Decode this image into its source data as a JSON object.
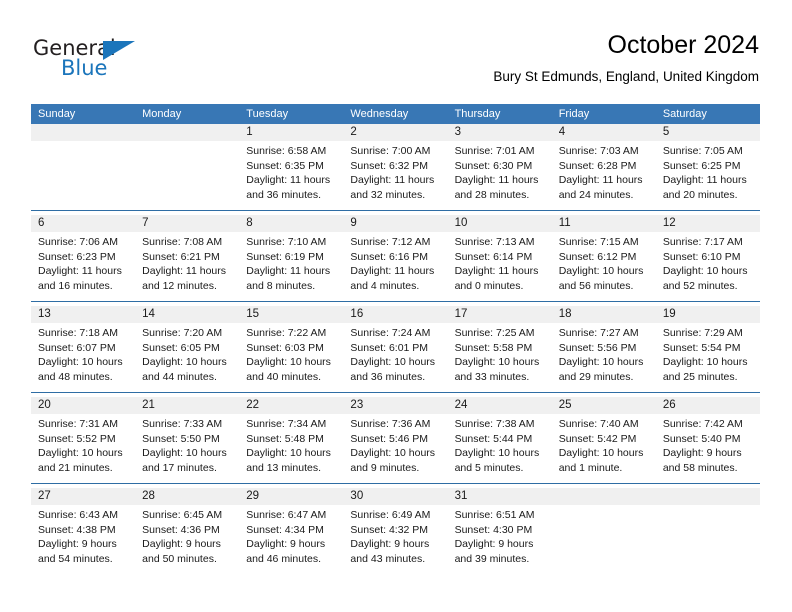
{
  "brand": {
    "name_part1": "General",
    "name_part2": "Blue",
    "triangle_icon": "triangle-icon",
    "accent_color": "#1b75bb"
  },
  "header": {
    "title": "October 2024",
    "subtitle": "Bury St Edmunds, England, United Kingdom"
  },
  "calendar": {
    "header_bg": "#3877b5",
    "daynum_bg": "#f0f0f0",
    "row_divider_color": "#2e6da4",
    "weekdays": [
      "Sunday",
      "Monday",
      "Tuesday",
      "Wednesday",
      "Thursday",
      "Friday",
      "Saturday"
    ],
    "weeks": [
      {
        "days": [
          {
            "num": "",
            "lines": []
          },
          {
            "num": "",
            "lines": []
          },
          {
            "num": "1",
            "lines": [
              "Sunrise: 6:58 AM",
              "Sunset: 6:35 PM",
              "Daylight: 11 hours and 36 minutes."
            ]
          },
          {
            "num": "2",
            "lines": [
              "Sunrise: 7:00 AM",
              "Sunset: 6:32 PM",
              "Daylight: 11 hours and 32 minutes."
            ]
          },
          {
            "num": "3",
            "lines": [
              "Sunrise: 7:01 AM",
              "Sunset: 6:30 PM",
              "Daylight: 11 hours and 28 minutes."
            ]
          },
          {
            "num": "4",
            "lines": [
              "Sunrise: 7:03 AM",
              "Sunset: 6:28 PM",
              "Daylight: 11 hours and 24 minutes."
            ]
          },
          {
            "num": "5",
            "lines": [
              "Sunrise: 7:05 AM",
              "Sunset: 6:25 PM",
              "Daylight: 11 hours and 20 minutes."
            ]
          }
        ]
      },
      {
        "days": [
          {
            "num": "6",
            "lines": [
              "Sunrise: 7:06 AM",
              "Sunset: 6:23 PM",
              "Daylight: 11 hours and 16 minutes."
            ]
          },
          {
            "num": "7",
            "lines": [
              "Sunrise: 7:08 AM",
              "Sunset: 6:21 PM",
              "Daylight: 11 hours and 12 minutes."
            ]
          },
          {
            "num": "8",
            "lines": [
              "Sunrise: 7:10 AM",
              "Sunset: 6:19 PM",
              "Daylight: 11 hours and 8 minutes."
            ]
          },
          {
            "num": "9",
            "lines": [
              "Sunrise: 7:12 AM",
              "Sunset: 6:16 PM",
              "Daylight: 11 hours and 4 minutes."
            ]
          },
          {
            "num": "10",
            "lines": [
              "Sunrise: 7:13 AM",
              "Sunset: 6:14 PM",
              "Daylight: 11 hours and 0 minutes."
            ]
          },
          {
            "num": "11",
            "lines": [
              "Sunrise: 7:15 AM",
              "Sunset: 6:12 PM",
              "Daylight: 10 hours and 56 minutes."
            ]
          },
          {
            "num": "12",
            "lines": [
              "Sunrise: 7:17 AM",
              "Sunset: 6:10 PM",
              "Daylight: 10 hours and 52 minutes."
            ]
          }
        ]
      },
      {
        "days": [
          {
            "num": "13",
            "lines": [
              "Sunrise: 7:18 AM",
              "Sunset: 6:07 PM",
              "Daylight: 10 hours and 48 minutes."
            ]
          },
          {
            "num": "14",
            "lines": [
              "Sunrise: 7:20 AM",
              "Sunset: 6:05 PM",
              "Daylight: 10 hours and 44 minutes."
            ]
          },
          {
            "num": "15",
            "lines": [
              "Sunrise: 7:22 AM",
              "Sunset: 6:03 PM",
              "Daylight: 10 hours and 40 minutes."
            ]
          },
          {
            "num": "16",
            "lines": [
              "Sunrise: 7:24 AM",
              "Sunset: 6:01 PM",
              "Daylight: 10 hours and 36 minutes."
            ]
          },
          {
            "num": "17",
            "lines": [
              "Sunrise: 7:25 AM",
              "Sunset: 5:58 PM",
              "Daylight: 10 hours and 33 minutes."
            ]
          },
          {
            "num": "18",
            "lines": [
              "Sunrise: 7:27 AM",
              "Sunset: 5:56 PM",
              "Daylight: 10 hours and 29 minutes."
            ]
          },
          {
            "num": "19",
            "lines": [
              "Sunrise: 7:29 AM",
              "Sunset: 5:54 PM",
              "Daylight: 10 hours and 25 minutes."
            ]
          }
        ]
      },
      {
        "days": [
          {
            "num": "20",
            "lines": [
              "Sunrise: 7:31 AM",
              "Sunset: 5:52 PM",
              "Daylight: 10 hours and 21 minutes."
            ]
          },
          {
            "num": "21",
            "lines": [
              "Sunrise: 7:33 AM",
              "Sunset: 5:50 PM",
              "Daylight: 10 hours and 17 minutes."
            ]
          },
          {
            "num": "22",
            "lines": [
              "Sunrise: 7:34 AM",
              "Sunset: 5:48 PM",
              "Daylight: 10 hours and 13 minutes."
            ]
          },
          {
            "num": "23",
            "lines": [
              "Sunrise: 7:36 AM",
              "Sunset: 5:46 PM",
              "Daylight: 10 hours and 9 minutes."
            ]
          },
          {
            "num": "24",
            "lines": [
              "Sunrise: 7:38 AM",
              "Sunset: 5:44 PM",
              "Daylight: 10 hours and 5 minutes."
            ]
          },
          {
            "num": "25",
            "lines": [
              "Sunrise: 7:40 AM",
              "Sunset: 5:42 PM",
              "Daylight: 10 hours and 1 minute."
            ]
          },
          {
            "num": "26",
            "lines": [
              "Sunrise: 7:42 AM",
              "Sunset: 5:40 PM",
              "Daylight: 9 hours and 58 minutes."
            ]
          }
        ]
      },
      {
        "days": [
          {
            "num": "27",
            "lines": [
              "Sunrise: 6:43 AM",
              "Sunset: 4:38 PM",
              "Daylight: 9 hours and 54 minutes."
            ]
          },
          {
            "num": "28",
            "lines": [
              "Sunrise: 6:45 AM",
              "Sunset: 4:36 PM",
              "Daylight: 9 hours and 50 minutes."
            ]
          },
          {
            "num": "29",
            "lines": [
              "Sunrise: 6:47 AM",
              "Sunset: 4:34 PM",
              "Daylight: 9 hours and 46 minutes."
            ]
          },
          {
            "num": "30",
            "lines": [
              "Sunrise: 6:49 AM",
              "Sunset: 4:32 PM",
              "Daylight: 9 hours and 43 minutes."
            ]
          },
          {
            "num": "31",
            "lines": [
              "Sunrise: 6:51 AM",
              "Sunset: 4:30 PM",
              "Daylight: 9 hours and 39 minutes."
            ]
          },
          {
            "num": "",
            "lines": []
          },
          {
            "num": "",
            "lines": []
          }
        ]
      }
    ]
  }
}
